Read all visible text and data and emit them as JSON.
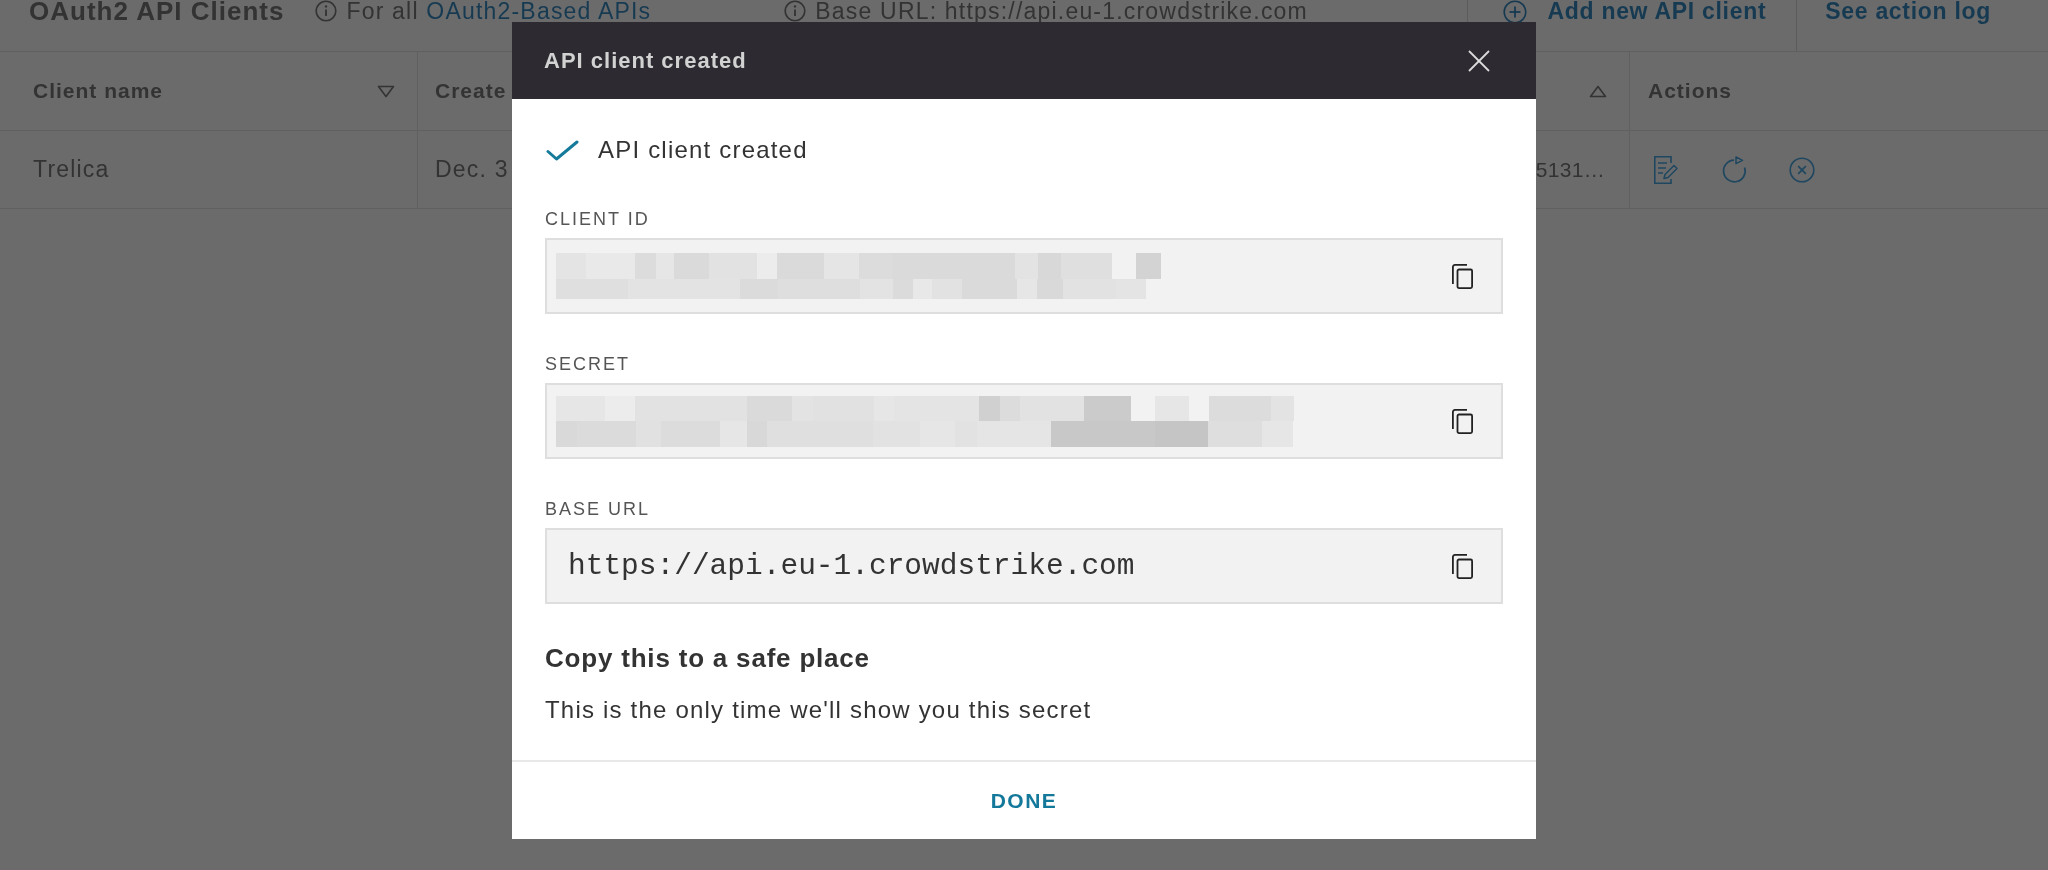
{
  "page": {
    "title": "OAuth2 API Clients",
    "scope_note": {
      "prefix": "For all ",
      "link": "OAuth2-Based APIs"
    },
    "base_url_note": "Base URL: https://api.eu-1.crowdstrike.com",
    "actions": [
      {
        "kind": "add",
        "label": "Add new API client"
      },
      {
        "kind": "plain",
        "label": "See action log"
      }
    ]
  },
  "table": {
    "columns": [
      {
        "label": "Client name",
        "ascending": false
      },
      {
        "label": "Create"
      },
      {
        "ascending": true
      },
      {
        "label": "Actions"
      }
    ],
    "rows": [
      {
        "cells": [
          "Trelica",
          "Dec. 3",
          "5131…"
        ]
      }
    ]
  },
  "dialog": {
    "title": "API client created",
    "status": "API client created",
    "fields": [
      {
        "label": "CLIENT ID",
        "redacted": true
      },
      {
        "label": "SECRET",
        "redacted": true
      },
      {
        "label": "BASE URL",
        "redacted": false,
        "value": "https://api.eu-1.crowdstrike.com"
      }
    ],
    "notice": {
      "heading": "Copy this to a safe place",
      "text": "This is the only time we'll show you this secret"
    },
    "buttons": [
      "DONE"
    ]
  }
}
